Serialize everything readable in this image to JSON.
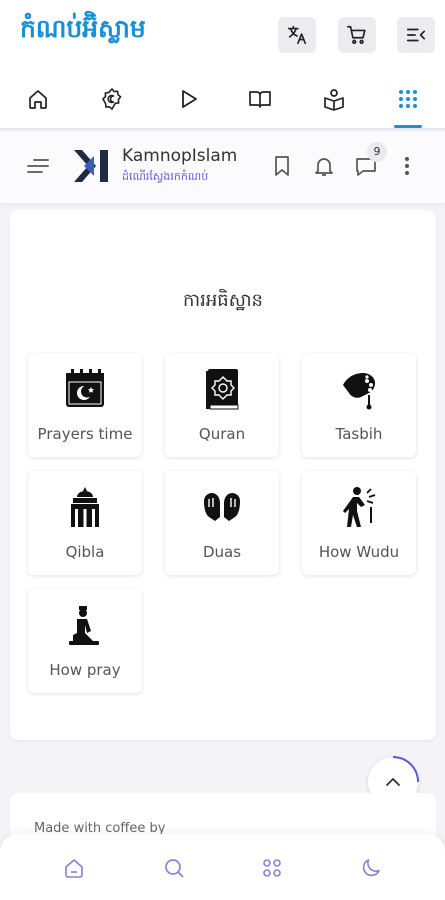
{
  "header": {
    "title": "កំណប់អ៊ិស្លាម",
    "actions": [
      {
        "name": "translate-icon"
      },
      {
        "name": "cart-icon"
      },
      {
        "name": "menu-collapse-icon"
      }
    ],
    "tabs": [
      {
        "name": "home-icon"
      },
      {
        "name": "prayer-settings-icon"
      },
      {
        "name": "play-icon"
      },
      {
        "name": "book-open-icon"
      },
      {
        "name": "reader-icon"
      },
      {
        "name": "apps-grid-icon",
        "active": true
      }
    ]
  },
  "site": {
    "name": "KamnopIslam",
    "tagline": "ដំណើរស្វែងរកកំណប់",
    "badge_count": "9"
  },
  "section": {
    "title": "ការអធិស្ឋាន",
    "items": [
      {
        "label": "Prayers time",
        "icon": "calendar-moon-icon"
      },
      {
        "label": "Quran",
        "icon": "quran-book-icon"
      },
      {
        "label": "Tasbih",
        "icon": "tasbih-hand-icon"
      },
      {
        "label": "Qibla",
        "icon": "kaaba-icon"
      },
      {
        "label": "Duas",
        "icon": "praying-hands-icon"
      },
      {
        "label": "How Wudu",
        "icon": "wudu-person-icon"
      },
      {
        "label": "How pray",
        "icon": "kneeling-person-icon"
      }
    ]
  },
  "footer": {
    "text": "Made with coffee by"
  },
  "bottom_nav": [
    {
      "name": "home-icon"
    },
    {
      "name": "search-icon"
    },
    {
      "name": "apps-icon"
    },
    {
      "name": "moon-icon"
    }
  ],
  "colors": {
    "brand": "#1a8fd6",
    "accent": "#6a5bd6"
  }
}
